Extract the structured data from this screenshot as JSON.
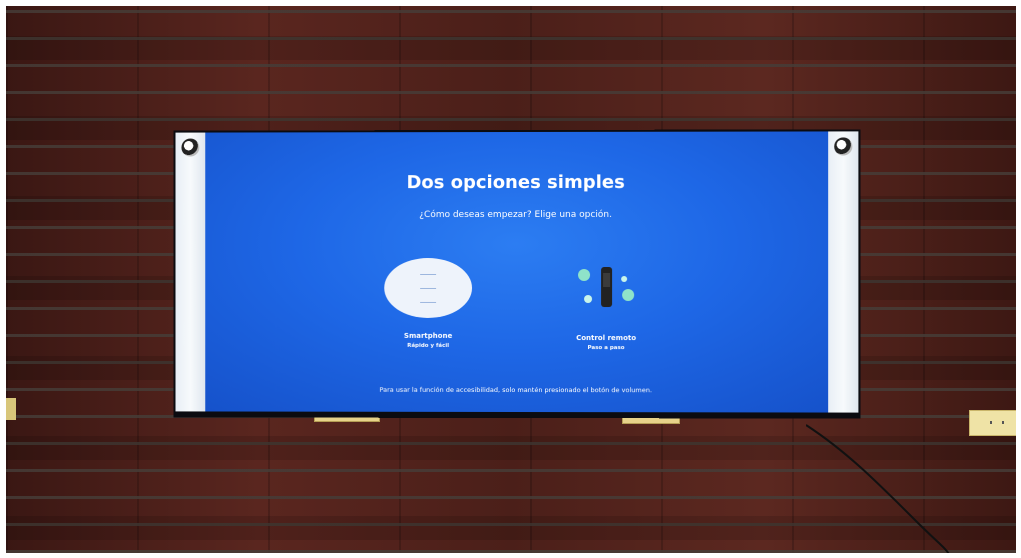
{
  "screen": {
    "title": "Dos opciones simples",
    "subtitle": "¿Cómo deseas empezar? Elige una opción.",
    "options": [
      {
        "label": "Smartphone",
        "sublabel": "Rápido y fácil",
        "icon": "smartphone-icon"
      },
      {
        "label": "Control remoto",
        "sublabel": "Paso a paso",
        "icon": "remote-control-icon"
      }
    ],
    "footer": "Para usar la función de accesibilidad, solo mantén presionado el botón de volumen."
  },
  "colors": {
    "screen_blue": "#1e67e6",
    "wall_brick": "#4b1f19"
  }
}
